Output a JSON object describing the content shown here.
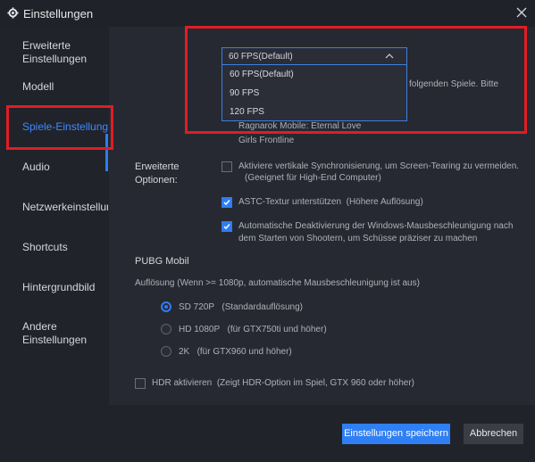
{
  "window": {
    "title": "Einstellungen",
    "close_icon": "close-icon",
    "gear_icon": "gear-icon"
  },
  "sidebar": {
    "items": [
      {
        "label_line1": "Erweiterte",
        "label_line2": "Einstellungen"
      },
      {
        "label": "Modell"
      },
      {
        "label": "Spiele-Einstellungen"
      },
      {
        "label": "Audio"
      },
      {
        "label": "Netzwerkeinstellungen"
      },
      {
        "label": "Shortcuts"
      },
      {
        "label": "Hintergrundbild"
      },
      {
        "label_line1": "Andere",
        "label_line2": "Einstellungen"
      }
    ]
  },
  "fps": {
    "selected": "60 FPS(Default)",
    "options": [
      "60 FPS(Default)",
      "90 FPS",
      "120 FPS"
    ],
    "partial_text": "folgenden Spiele. Bitte",
    "games": [
      "Ragnarok Mobile: Eternal Love",
      "Girls Frontline"
    ]
  },
  "advanced": {
    "label_line1": "Erweiterte",
    "label_line2": "Optionen:",
    "vsync_line1": "Aktiviere vertikale Synchronisierung, um Screen-Tearing zu vermeiden.",
    "vsync_line2": "(Geeignet für High-End Computer)",
    "astc": "ASTC-Textur unterstützen",
    "astc_note": "(Höhere Auflösung)",
    "mouse_line1": "Automatische Deaktivierung der Windows-Mausbeschleunigung nach",
    "mouse_line2": "dem Starten von Shootern, um Schüsse präziser zu machen"
  },
  "pubg": {
    "title": "PUBG Mobil",
    "resolution_label": "Auflösung (Wenn >= 1080p, automatische Mausbeschleunigung ist aus)",
    "options": [
      {
        "name": "SD 720P",
        "note": "(Standardauflösung)"
      },
      {
        "name": "HD 1080P",
        "note": "(für GTX750ti und höher)"
      },
      {
        "name": "2K",
        "note": "(für GTX960 und höher)"
      }
    ],
    "hdr": "HDR aktivieren",
    "hdr_note": "(Zeigt HDR-Option im Spiel, GTX 960 oder höher)"
  },
  "footer": {
    "save": "Einstellungen speichern",
    "cancel": "Abbrechen"
  },
  "colors": {
    "accent": "#2e7cf6",
    "highlight": "#e21c24"
  }
}
